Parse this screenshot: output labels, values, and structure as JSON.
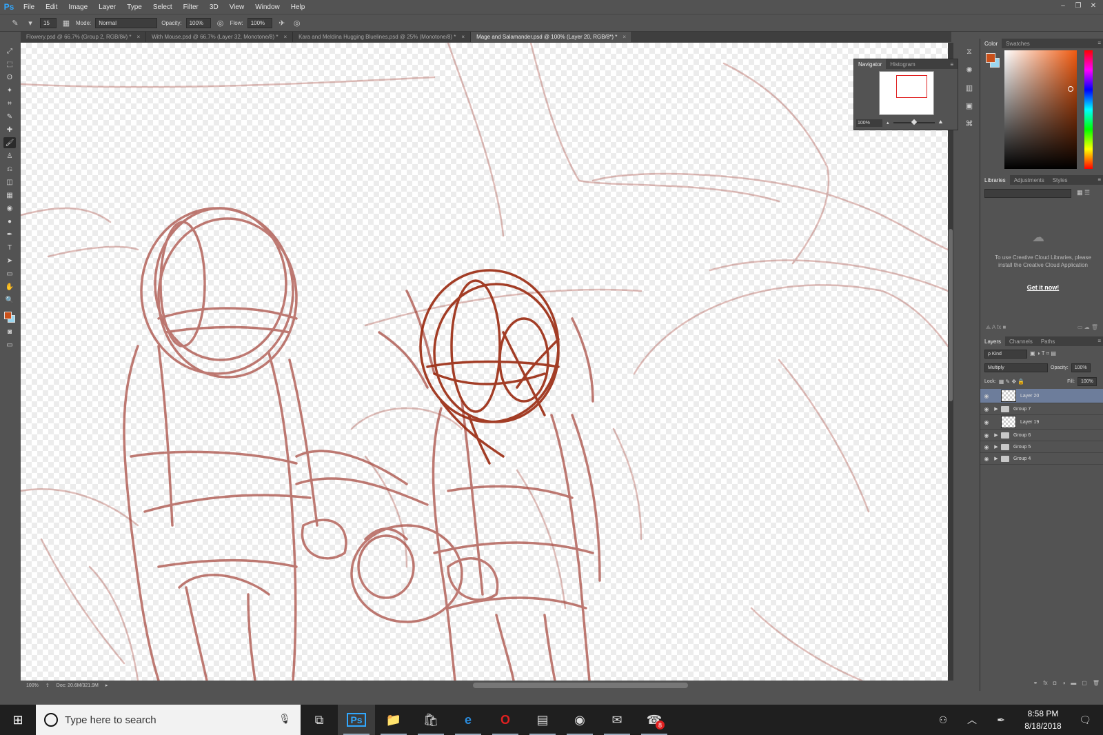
{
  "app": {
    "logo": "Ps",
    "window_controls": [
      "–",
      "❐",
      "✕"
    ]
  },
  "menu": [
    "File",
    "Edit",
    "Image",
    "Layer",
    "Type",
    "Select",
    "Filter",
    "3D",
    "View",
    "Window",
    "Help"
  ],
  "options": {
    "brush_size": "15",
    "mode_label": "Mode:",
    "mode_value": "Normal",
    "opacity_label": "Opacity:",
    "opacity_value": "100%",
    "flow_label": "Flow:",
    "flow_value": "100%"
  },
  "tabs": [
    {
      "label": "Flowery.psd @ 66.7% (Group 2, RGB/8#) *",
      "active": false
    },
    {
      "label": "With Mouse.psd @ 66.7% (Layer 32, Monotone/8) *",
      "active": false
    },
    {
      "label": "Kara and Meldina Hugging Bluelines.psd @ 25% (Monotone/8) *",
      "active": false
    },
    {
      "label": "Mage and Salamander.psd @ 100% (Layer 20, RGB/8*) *",
      "active": true
    }
  ],
  "tools": [
    "⤢",
    "⬚",
    "ʘ",
    "✦",
    "⌗",
    "✎",
    "✚",
    "🖌",
    "♙",
    "⎌",
    "◫",
    "▦",
    "◉",
    "●",
    "✒",
    "T",
    "➤",
    "▭",
    "✋",
    "🔍"
  ],
  "colors": {
    "foreground": "#c9501a",
    "background": "#9ad6ef",
    "stroke": "#a5443a",
    "stroke_dark": "#9a2a10",
    "accent_sel": "#6d7d9b"
  },
  "status": {
    "zoom": "100%",
    "doc": "Doc: 20.6M/321.9M"
  },
  "navigator": {
    "tabs": [
      "Navigator",
      "Histogram"
    ],
    "zoom": "100%"
  },
  "color_panel": {
    "tabs": [
      "Color",
      "Swatches"
    ]
  },
  "libraries": {
    "tabs": [
      "Libraries",
      "Adjustments",
      "Styles"
    ],
    "message": "To use Creative Cloud Libraries, please install the Creative Cloud Application",
    "link": "Get it now!"
  },
  "layers": {
    "tabs": [
      "Layers",
      "Channels",
      "Paths"
    ],
    "filter_label": "ρ Kind",
    "blend_mode": "Multiply",
    "opacity_label": "Opacity:",
    "opacity_value": "100%",
    "lock_label": "Lock:",
    "fill_label": "Fill:",
    "fill_value": "100%",
    "items": [
      {
        "name": "Layer 20",
        "type": "layer",
        "selected": true
      },
      {
        "name": "Group 7",
        "type": "group",
        "selected": false
      },
      {
        "name": "Layer 19",
        "type": "layer",
        "selected": false
      },
      {
        "name": "Group 6",
        "type": "group",
        "selected": false
      },
      {
        "name": "Group 5",
        "type": "group",
        "selected": false
      },
      {
        "name": "Group 4",
        "type": "group",
        "selected": false
      }
    ]
  },
  "taskbar": {
    "search_placeholder": "Type here to search",
    "apps": [
      "task-view",
      "photoshop",
      "file-explorer",
      "store",
      "edge",
      "opera",
      "scanner",
      "chrome",
      "outlook",
      "discord"
    ],
    "app_glyphs": [
      "⧉",
      "Ps",
      "📁",
      "🛍",
      "e",
      "O",
      "▤",
      "◉",
      "✉",
      "☎"
    ],
    "discord_badge": "8",
    "time": "8:58 PM",
    "date": "8/18/2018"
  }
}
